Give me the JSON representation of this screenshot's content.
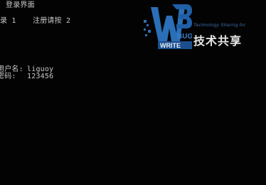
{
  "console": {
    "title": "登录界面",
    "menu": {
      "login": "录 1",
      "register": "注册请按 2"
    },
    "fields": {
      "username_label": "用户名:",
      "username_value": "liguoy",
      "password_label": "密码:",
      "password_value": "123456"
    }
  },
  "watermark": {
    "tagline": "Technology Sharing for",
    "brand": "技术共享",
    "logo_text": "WBUGWRITE",
    "accent_color": "#2a6fb7"
  }
}
